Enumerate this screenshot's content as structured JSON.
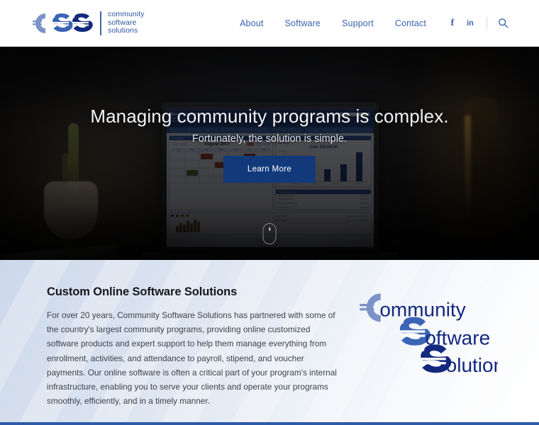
{
  "header": {
    "logo": {
      "mark_letters": "css",
      "tagline_line1": "community",
      "tagline_line2": "software",
      "tagline_line3": "solutions",
      "colors": {
        "light": "#7b93c8",
        "mid": "#3a64b4",
        "dark": "#13287e"
      }
    },
    "nav": [
      {
        "label": "About"
      },
      {
        "label": "Software"
      },
      {
        "label": "Support"
      },
      {
        "label": "Contact"
      }
    ],
    "social": [
      {
        "name": "facebook",
        "glyph": "f"
      },
      {
        "name": "linkedin",
        "glyph": "in"
      }
    ],
    "search_icon": "search-icon",
    "link_color": "#3a64b4"
  },
  "hero": {
    "title": "Managing community programs is complex.",
    "subtitle": "Fortunately, the solution is simple.",
    "cta_label": "Learn More",
    "cta_color": "#123a7a",
    "scroll_indicator": "scroll-down-mouse-icon",
    "dashboard": {
      "app_title": "Best Animal Rescue",
      "app_sub1": "Community Program Management Software",
      "app_sub2": "Enroll • Manage • Report",
      "calendar_month": "August 2017",
      "weekdays": [
        "Sun",
        "Mon",
        "Tue",
        "Wed",
        "Thu",
        "Fri",
        "Sat"
      ],
      "chart_total": "Total: $29,229.00",
      "chart_filter": "Date Range:",
      "yticks": [
        "$12,000.00",
        "$9,000.00",
        "$6,000.00",
        "$3,000.00",
        "$0.00"
      ],
      "xlabels": [
        "Stipend Pay",
        "Mileage",
        "Voucher Usage",
        "Total Amount",
        "Total Hours"
      ],
      "bars": [
        32,
        52,
        40,
        56,
        96
      ],
      "table_rows": [
        {
          "label": "Voucher Payment",
          "value": "$7,120.00"
        },
        {
          "label": "Stipend Payment",
          "value": "$4,255.00"
        },
        {
          "label": "Mileage Reimbursement",
          "value": "$2,150.00"
        },
        {
          "label": "Activity Expense",
          "value": "$1,308.00"
        }
      ],
      "mini_rows": [
        {
          "label": "New Enrollment",
          "value": "View Info • Update Profile"
        },
        {
          "label": "Program Report",
          "value": "View Info • Update Profile"
        }
      ],
      "mini_bars": [
        9,
        13,
        11,
        16,
        13,
        18,
        15
      ]
    }
  },
  "content": {
    "title": "Custom Online Software Solutions",
    "body": "For over 20 years, Community Software Solutions has partnered with some of the country's largest community programs, providing online customized software products and expert support to help them manage everything from enrollment, activities, and attendance to payroll, stipend, and voucher payments. Our online software is often a critical part of your program's internal infrastructure, enabling you to serve your clients and operate your programs smoothly, efficiently, and in a timely manner.",
    "brand_graphic": {
      "line1": "Community",
      "line2": "Software",
      "line3": "Solutions",
      "color1": "#7b93c8",
      "color2": "#3a64b4",
      "color3": "#13287e"
    }
  },
  "footer": {
    "bar_color": "#2e5aa8"
  }
}
